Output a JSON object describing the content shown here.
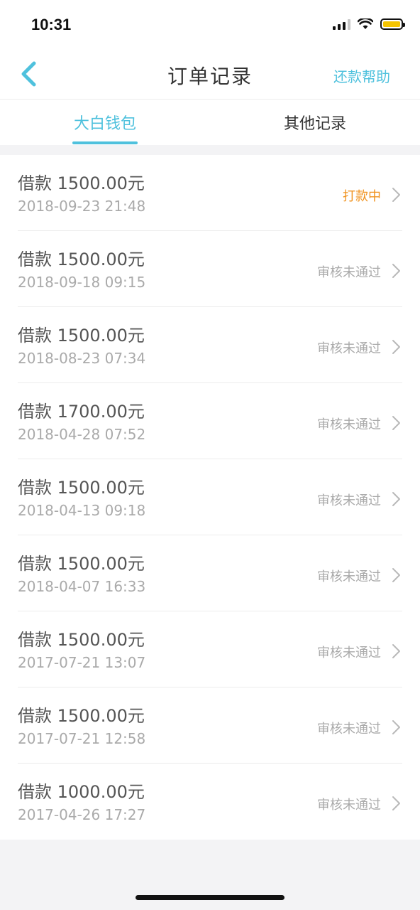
{
  "status_bar": {
    "time": "10:31",
    "battery_color": "#f5c400"
  },
  "nav": {
    "title": "订单记录",
    "help_label": "还款帮助",
    "back_icon": "chevron-left-icon",
    "accent_color": "#4fc1dd"
  },
  "tabs": [
    {
      "label": "大白钱包",
      "active": true
    },
    {
      "label": "其他记录",
      "active": false
    }
  ],
  "status_colors": {
    "processing": "#f0921e",
    "rejected": "#aaaaaa"
  },
  "orders": [
    {
      "title": "借款 1500.00元",
      "date": "2018-09-23 21:48",
      "status": "打款中",
      "status_type": "processing"
    },
    {
      "title": "借款 1500.00元",
      "date": "2018-09-18 09:15",
      "status": "审核未通过",
      "status_type": "rejected"
    },
    {
      "title": "借款 1500.00元",
      "date": "2018-08-23 07:34",
      "status": "审核未通过",
      "status_type": "rejected"
    },
    {
      "title": "借款 1700.00元",
      "date": "2018-04-28 07:52",
      "status": "审核未通过",
      "status_type": "rejected"
    },
    {
      "title": "借款 1500.00元",
      "date": "2018-04-13 09:18",
      "status": "审核未通过",
      "status_type": "rejected"
    },
    {
      "title": "借款 1500.00元",
      "date": "2018-04-07 16:33",
      "status": "审核未通过",
      "status_type": "rejected"
    },
    {
      "title": "借款 1500.00元",
      "date": "2017-07-21 13:07",
      "status": "审核未通过",
      "status_type": "rejected"
    },
    {
      "title": "借款 1500.00元",
      "date": "2017-07-21 12:58",
      "status": "审核未通过",
      "status_type": "rejected"
    },
    {
      "title": "借款 1000.00元",
      "date": "2017-04-26 17:27",
      "status": "审核未通过",
      "status_type": "rejected"
    }
  ]
}
